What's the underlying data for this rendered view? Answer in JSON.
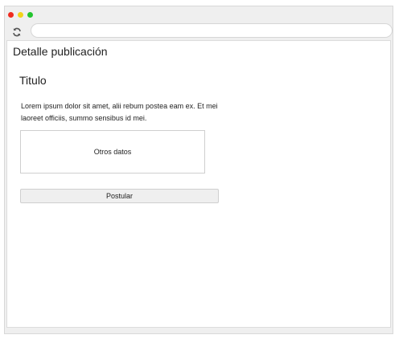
{
  "browser": {
    "controls": [
      "close-icon",
      "minimize-icon",
      "maximize-icon"
    ],
    "colors": {
      "close": "#ef2b1f",
      "minimize": "#f2d318",
      "maximize": "#23c42e"
    },
    "refresh_icon": "refresh-icon",
    "url": ""
  },
  "page": {
    "title": "Detalle publicación"
  },
  "post": {
    "title": "Titulo",
    "body": "Lorem ipsum dolor sit amet, alii rebum postea eam ex. Et mei laoreet officiis, summo sensibus id mei.",
    "other_data": "Otros datos",
    "apply_label": "Postular"
  }
}
